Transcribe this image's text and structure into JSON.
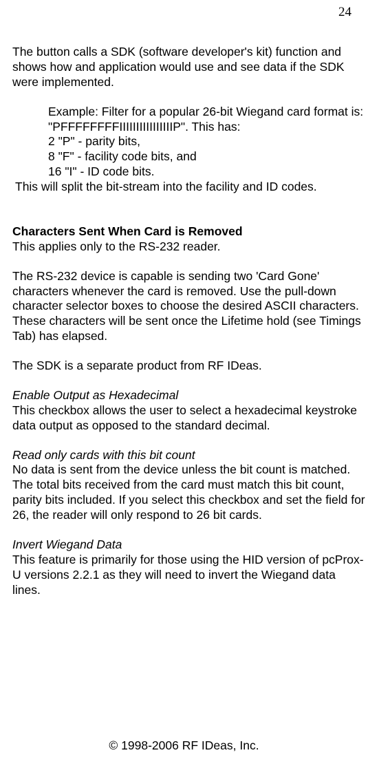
{
  "pageNumber": "24",
  "intro": "The button calls a SDK (software developer's kit) function and shows how and application would use and see data if the SDK were implemented.",
  "example": {
    "line1": "Example: Filter for a popular 26-bit Wiegand card format is: \"PFFFFFFFFIIIIIIIIIIIIIIIIP\". This has:",
    "line2": "2 \"P\" - parity bits,",
    "line3": "8 \"F\" - facility code bits, and",
    "line4": "16 \"I\" - ID code bits."
  },
  "splitLine": "This will split the bit-stream into the facility and ID codes.",
  "section1": {
    "heading": "Characters Sent When Card is Removed",
    "line1": "This applies only to the RS-232 reader.",
    "para2": "The RS-232 device is capable is sending two 'Card Gone' characters whenever the card is removed. Use the pull-down character selector boxes to choose the desired ASCII characters. These characters will be sent once the Lifetime hold (see Timings Tab) has elapsed.",
    "para3": "The SDK is a separate product from RF IDeas."
  },
  "section2": {
    "heading": "Enable Output as Hexadecimal",
    "body": "This checkbox allows the user to select a hexadecimal keystroke data output as opposed to the standard decimal."
  },
  "section3": {
    "heading": "Read only cards with this bit count",
    "body": "No data is sent from the device unless the bit count is matched. The total bits received from the card must match this bit count, parity bits included. If you select this checkbox and set the field for 26, the reader will only respond to 26 bit cards."
  },
  "section4": {
    "heading": "Invert Wiegand Data",
    "body": "This feature is primarily for those using the HID version of pcProx-U versions 2.2.1 as they will need to invert the Wiegand data lines."
  },
  "footer": "© 1998-2006 RF IDeas, Inc."
}
